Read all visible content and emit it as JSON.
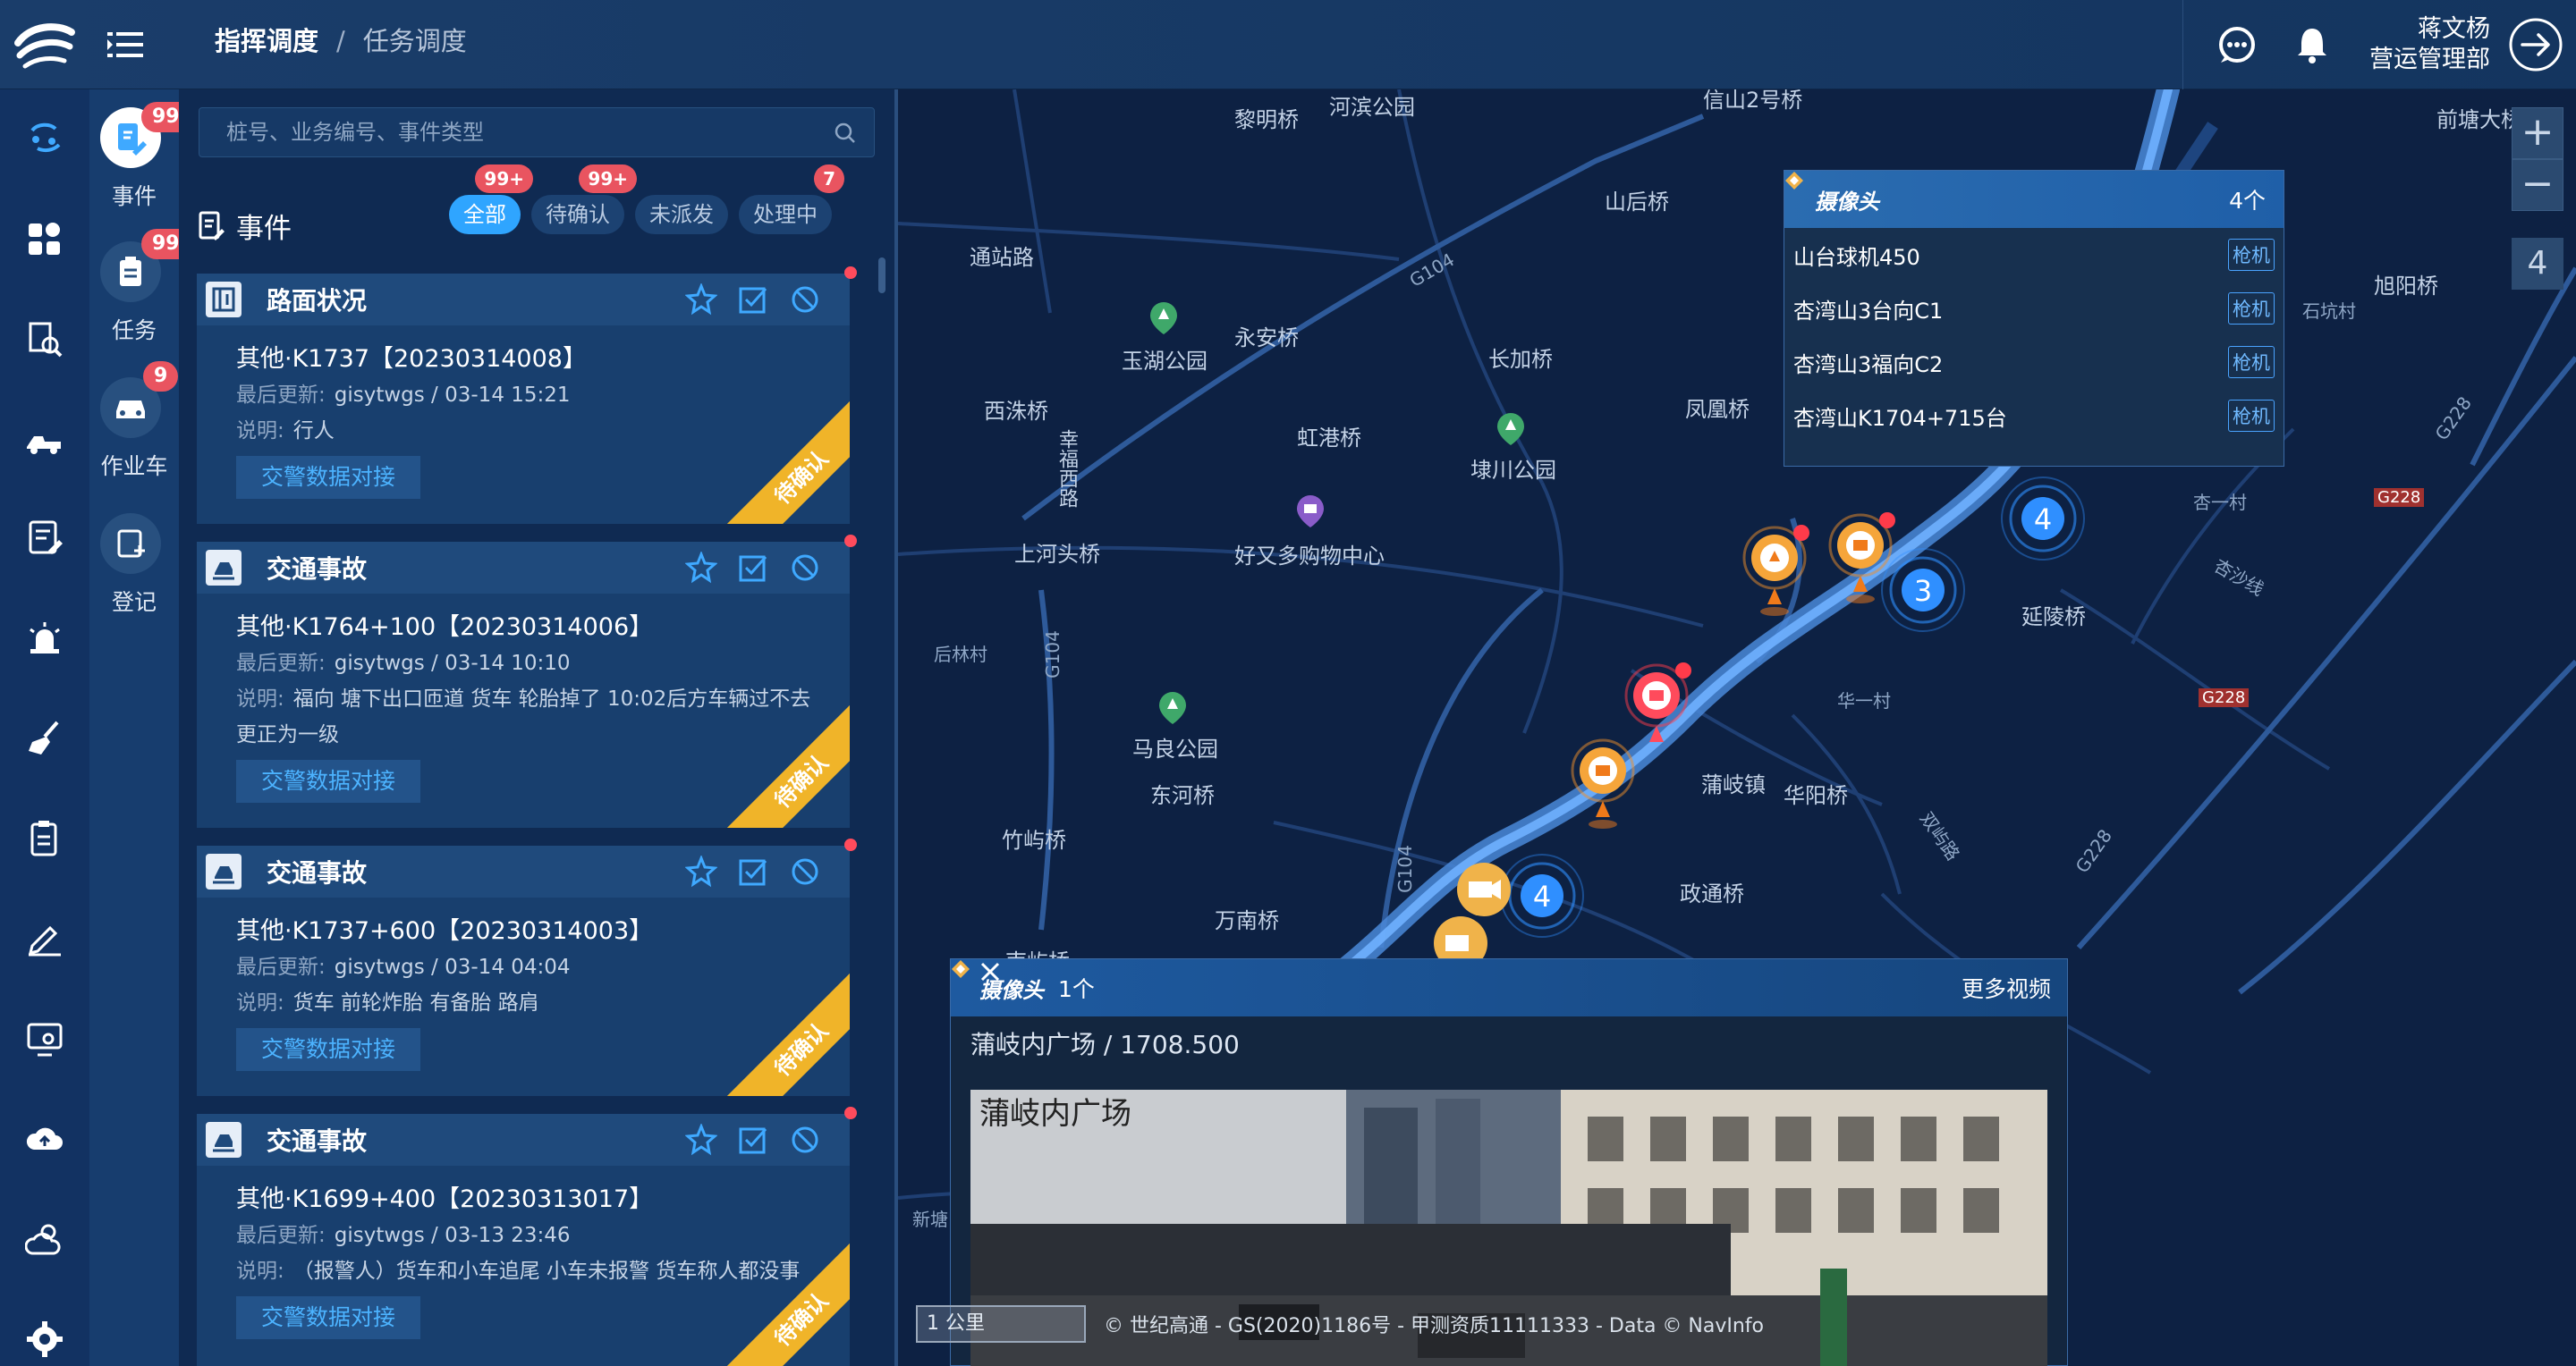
{
  "header": {
    "breadcrumb_main": "指挥调度",
    "breadcrumb_sep": "/",
    "breadcrumb_sub": "任务调度",
    "user_name": "蒋文杨",
    "user_dept": "营运管理部"
  },
  "subnav": [
    {
      "label": "事件",
      "badge": "99+"
    },
    {
      "label": "任务",
      "badge": "99+"
    },
    {
      "label": "作业车",
      "badge": "9"
    },
    {
      "label": "登记",
      "badge": ""
    }
  ],
  "panel": {
    "search_placeholder": "桩号、业务编号、事件类型",
    "title": "事件",
    "filters": [
      {
        "label": "全部",
        "badge": "99+"
      },
      {
        "label": "待确认",
        "badge": "99+"
      },
      {
        "label": "未派发",
        "badge": ""
      },
      {
        "label": "处理中",
        "badge": "7"
      }
    ]
  },
  "events": [
    {
      "type": "路面状况",
      "title": "其他·K1737【20230314008】",
      "updated_label": "最后更新:",
      "updated": "gisytwgs / 03-14 15:21",
      "desc_label": "说明:",
      "desc": "行人",
      "button": "交警数据对接",
      "status": "待确认"
    },
    {
      "type": "交通事故",
      "title": "其他·K1764+100【20230314006】",
      "updated_label": "最后更新:",
      "updated": "gisytwgs / 03-14 10:10",
      "desc_label": "说明:",
      "desc": "福向 塘下出口匝道 货车 轮胎掉了 10:02后方车辆过不去更正为一级",
      "button": "交警数据对接",
      "status": "待确认"
    },
    {
      "type": "交通事故",
      "title": "其他·K1737+600【20230314003】",
      "updated_label": "最后更新:",
      "updated": "gisytwgs / 03-14 04:04",
      "desc_label": "说明:",
      "desc": "货车 前轮炸胎 有备胎 路肩",
      "button": "交警数据对接",
      "status": "待确认"
    },
    {
      "type": "交通事故",
      "title": "其他·K1699+400【20230313017】",
      "updated_label": "最后更新:",
      "updated": "gisytwgs / 03-13 23:46",
      "desc_label": "说明:",
      "desc": "（报警人）货车和小车追尾 小车未报警 货车称人都没事",
      "button": "交警数据对接",
      "status": "待确认"
    }
  ],
  "map": {
    "labels": [
      "黎明桥",
      "河滨公园",
      "信山2号桥",
      "山后桥",
      "前塘大桥",
      "通站路",
      "玉湖公园",
      "永安桥",
      "长加桥",
      "G104",
      "西洙桥",
      "虹港桥",
      "埭川公园",
      "凤凰桥",
      "幸福西路",
      "上河头桥",
      "好又多购物中心",
      "旭阳桥",
      "石坑村",
      "G228",
      "杏一村",
      "G228",
      "杏沙线",
      "延陵桥",
      "后林村",
      "G104",
      "华一村",
      "G228",
      "马良公园",
      "东河桥",
      "蒲岐镇",
      "华阳桥",
      "竹屿桥",
      "G104",
      "双屿路",
      "G228",
      "政通桥",
      "万南桥",
      "南屿桥",
      "新塘"
    ],
    "zoom_in": "+",
    "zoom_out": "−",
    "zoom_level": "4",
    "clusters": [
      "4",
      "3",
      "4"
    ]
  },
  "camera_popup": {
    "title": "摄像头",
    "count": "4个",
    "items": [
      {
        "name": "山台球机450",
        "tag": "枪机"
      },
      {
        "name": "杏湾山3台向C1",
        "tag": "枪机"
      },
      {
        "name": "杏湾山3福向C2",
        "tag": "枪机"
      },
      {
        "name": "杏湾山K1704+715台",
        "tag": "枪机"
      }
    ]
  },
  "video": {
    "title": "摄像头",
    "count": "1个",
    "more": "更多视频",
    "location": "蒲岐内广场 / 1708.500",
    "overlay_text": "蒲岐内广场"
  },
  "map_footer": {
    "scale": "1 公里",
    "copyright": "© 世纪高通 - GS(2020)1186号 - 甲测资质11111333 - Data © NavInfo"
  }
}
